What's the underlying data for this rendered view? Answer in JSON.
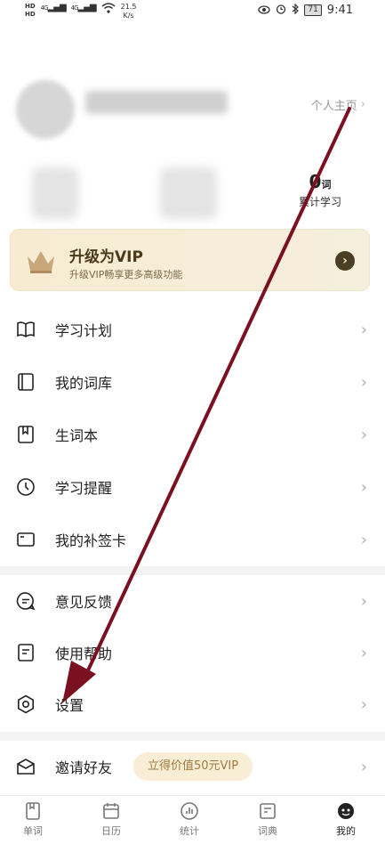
{
  "status_bar": {
    "hd_top": "HD",
    "hd_bottom": "HD",
    "signal1": "4G",
    "signal2": "4G",
    "speed_value": "21.5",
    "speed_unit": "K/s",
    "battery": "71",
    "time": "9:41"
  },
  "profile": {
    "homepage_link": "个人主页",
    "words_count": "0",
    "words_unit": "词",
    "words_label": "累计学习"
  },
  "vip_banner": {
    "title": "升级为VIP",
    "subtitle": "升级VIP畅享更多高级功能"
  },
  "menu": {
    "study_plan": "学习计划",
    "my_wordbank": "我的词库",
    "vocab_book": "生词本",
    "study_reminder": "学习提醒",
    "makeup_card": "我的补签卡",
    "feedback": "意见反馈",
    "help": "使用帮助",
    "settings": "设置",
    "invite": "邀请好友",
    "invite_badge": "立得价值50元VIP"
  },
  "tabs": [
    {
      "label": "单词",
      "icon": "book-icon"
    },
    {
      "label": "日历",
      "icon": "calendar-icon"
    },
    {
      "label": "统计",
      "icon": "stats-icon"
    },
    {
      "label": "词典",
      "icon": "dictionary-icon"
    },
    {
      "label": "我的",
      "icon": "profile-icon"
    }
  ],
  "active_tab": "我的",
  "colors": {
    "annotation_arrow": "#7a1020",
    "vip_dark": "#4a3e24",
    "vip_bg": "#f7ecd2"
  }
}
